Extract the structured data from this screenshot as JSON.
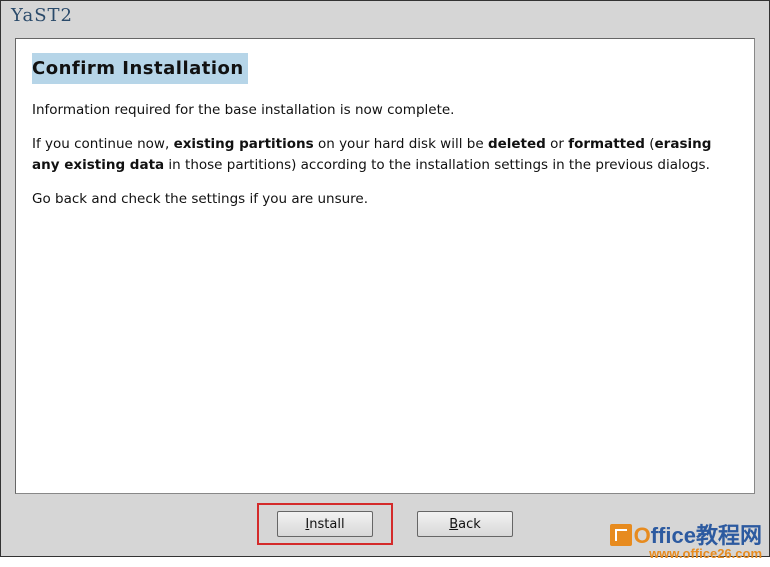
{
  "window": {
    "title": "YaST2"
  },
  "dialog": {
    "heading": "Confirm Installation",
    "para1": "Information required for the base installation is now complete.",
    "para2_prefix": "If you continue now, ",
    "para2_b1": "existing partitions",
    "para2_mid1": " on your hard disk will be ",
    "para2_b2": "deleted",
    "para2_mid2": " or ",
    "para2_b3": "formatted",
    "para2_mid3": " (",
    "para2_b4": "erasing any existing data",
    "para2_suffix": " in those partitions) according to the installation settings in the previous dialogs.",
    "para3": "Go back and check the settings if you are unsure."
  },
  "buttons": {
    "install_u": "I",
    "install_rest": "nstall",
    "back_u": "B",
    "back_rest": "ack"
  },
  "watermark": {
    "brand_o": "O",
    "brand_rest": "ffice",
    "brand_cn": "教程网",
    "url": "www.office26.com"
  }
}
